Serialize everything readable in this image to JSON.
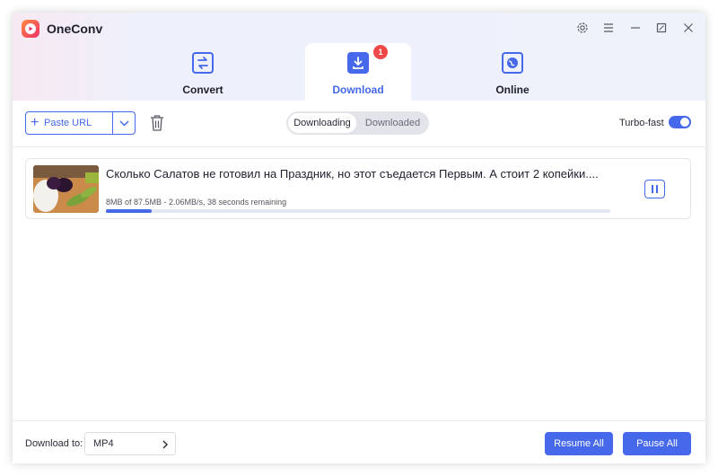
{
  "app": {
    "name": "OneConv"
  },
  "window_controls": {
    "icons": [
      "gear-icon",
      "menu-icon",
      "minimize-icon",
      "maximize-icon",
      "close-icon"
    ]
  },
  "tabs": [
    {
      "label": "Convert",
      "icon": "convert-arrows-icon",
      "active": false
    },
    {
      "label": "Download",
      "icon": "download-tray-icon",
      "active": true,
      "badge": "1"
    },
    {
      "label": "Online",
      "icon": "globe-icon",
      "active": false
    }
  ],
  "toolbar": {
    "paste_url_label": "Paste URL",
    "segment": {
      "options": [
        "Downloading",
        "Downloaded"
      ],
      "selected": "Downloading"
    },
    "turbo_label": "Turbo-fast",
    "turbo_on": true
  },
  "downloads": [
    {
      "title": "Сколько Салатов не готовил на Праздник, но этот съедается Первым. А стоит 2 копейки....",
      "stats": "8MB of 87.5MB -   2.06MB/s, 38 seconds remaining",
      "progress": 0.09
    }
  ],
  "footer": {
    "download_to_label": "Download to:",
    "format_value": "MP4",
    "resume_all_label": "Resume All",
    "pause_all_label": "Pause All"
  },
  "colors": {
    "accent": "#4668ea",
    "badge": "#f04848"
  }
}
